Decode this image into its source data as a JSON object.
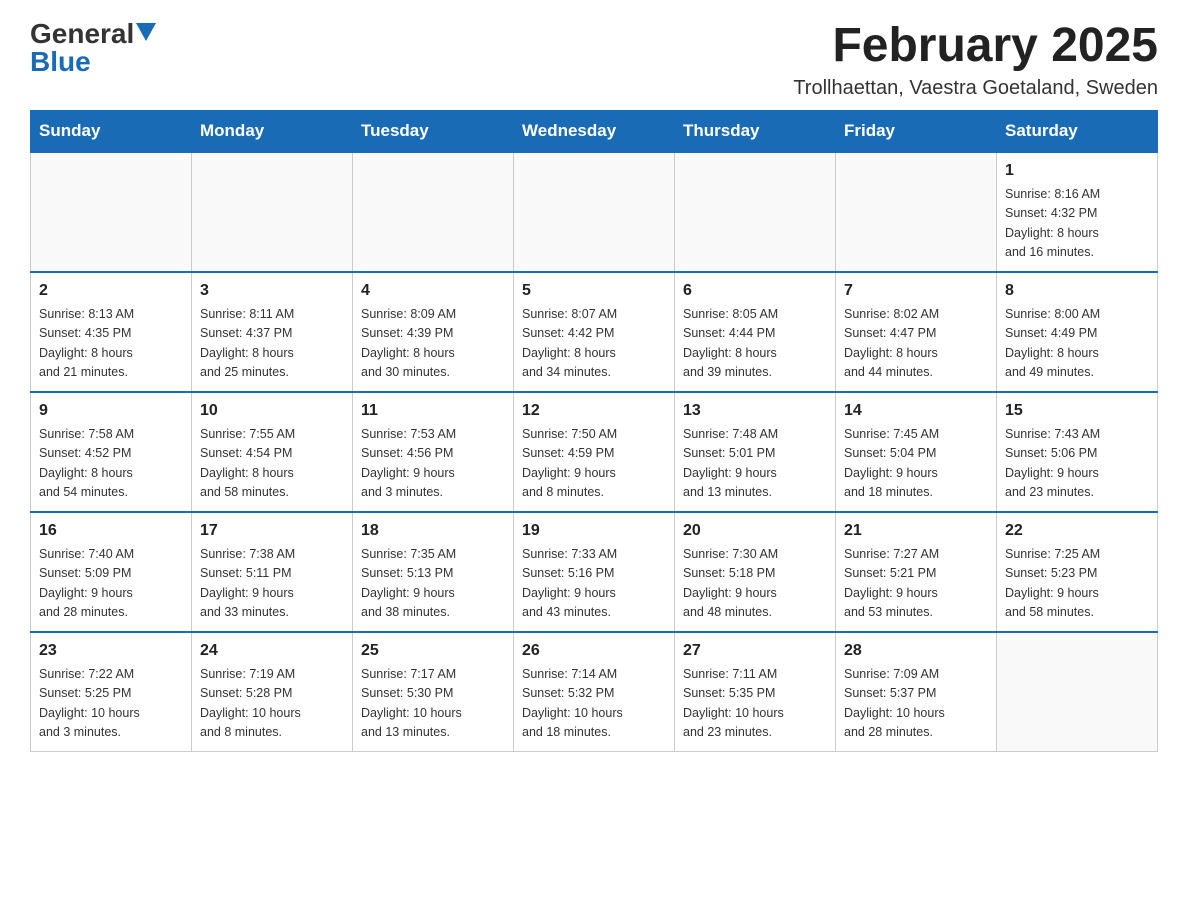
{
  "logo": {
    "general": "General",
    "blue": "Blue",
    "triangle": "▼"
  },
  "header": {
    "month_title": "February 2025",
    "location": "Trollhaettan, Vaestra Goetaland, Sweden"
  },
  "weekdays": [
    "Sunday",
    "Monday",
    "Tuesday",
    "Wednesday",
    "Thursday",
    "Friday",
    "Saturday"
  ],
  "weeks": [
    [
      {
        "day": "",
        "info": ""
      },
      {
        "day": "",
        "info": ""
      },
      {
        "day": "",
        "info": ""
      },
      {
        "day": "",
        "info": ""
      },
      {
        "day": "",
        "info": ""
      },
      {
        "day": "",
        "info": ""
      },
      {
        "day": "1",
        "info": "Sunrise: 8:16 AM\nSunset: 4:32 PM\nDaylight: 8 hours\nand 16 minutes."
      }
    ],
    [
      {
        "day": "2",
        "info": "Sunrise: 8:13 AM\nSunset: 4:35 PM\nDaylight: 8 hours\nand 21 minutes."
      },
      {
        "day": "3",
        "info": "Sunrise: 8:11 AM\nSunset: 4:37 PM\nDaylight: 8 hours\nand 25 minutes."
      },
      {
        "day": "4",
        "info": "Sunrise: 8:09 AM\nSunset: 4:39 PM\nDaylight: 8 hours\nand 30 minutes."
      },
      {
        "day": "5",
        "info": "Sunrise: 8:07 AM\nSunset: 4:42 PM\nDaylight: 8 hours\nand 34 minutes."
      },
      {
        "day": "6",
        "info": "Sunrise: 8:05 AM\nSunset: 4:44 PM\nDaylight: 8 hours\nand 39 minutes."
      },
      {
        "day": "7",
        "info": "Sunrise: 8:02 AM\nSunset: 4:47 PM\nDaylight: 8 hours\nand 44 minutes."
      },
      {
        "day": "8",
        "info": "Sunrise: 8:00 AM\nSunset: 4:49 PM\nDaylight: 8 hours\nand 49 minutes."
      }
    ],
    [
      {
        "day": "9",
        "info": "Sunrise: 7:58 AM\nSunset: 4:52 PM\nDaylight: 8 hours\nand 54 minutes."
      },
      {
        "day": "10",
        "info": "Sunrise: 7:55 AM\nSunset: 4:54 PM\nDaylight: 8 hours\nand 58 minutes."
      },
      {
        "day": "11",
        "info": "Sunrise: 7:53 AM\nSunset: 4:56 PM\nDaylight: 9 hours\nand 3 minutes."
      },
      {
        "day": "12",
        "info": "Sunrise: 7:50 AM\nSunset: 4:59 PM\nDaylight: 9 hours\nand 8 minutes."
      },
      {
        "day": "13",
        "info": "Sunrise: 7:48 AM\nSunset: 5:01 PM\nDaylight: 9 hours\nand 13 minutes."
      },
      {
        "day": "14",
        "info": "Sunrise: 7:45 AM\nSunset: 5:04 PM\nDaylight: 9 hours\nand 18 minutes."
      },
      {
        "day": "15",
        "info": "Sunrise: 7:43 AM\nSunset: 5:06 PM\nDaylight: 9 hours\nand 23 minutes."
      }
    ],
    [
      {
        "day": "16",
        "info": "Sunrise: 7:40 AM\nSunset: 5:09 PM\nDaylight: 9 hours\nand 28 minutes."
      },
      {
        "day": "17",
        "info": "Sunrise: 7:38 AM\nSunset: 5:11 PM\nDaylight: 9 hours\nand 33 minutes."
      },
      {
        "day": "18",
        "info": "Sunrise: 7:35 AM\nSunset: 5:13 PM\nDaylight: 9 hours\nand 38 minutes."
      },
      {
        "day": "19",
        "info": "Sunrise: 7:33 AM\nSunset: 5:16 PM\nDaylight: 9 hours\nand 43 minutes."
      },
      {
        "day": "20",
        "info": "Sunrise: 7:30 AM\nSunset: 5:18 PM\nDaylight: 9 hours\nand 48 minutes."
      },
      {
        "day": "21",
        "info": "Sunrise: 7:27 AM\nSunset: 5:21 PM\nDaylight: 9 hours\nand 53 minutes."
      },
      {
        "day": "22",
        "info": "Sunrise: 7:25 AM\nSunset: 5:23 PM\nDaylight: 9 hours\nand 58 minutes."
      }
    ],
    [
      {
        "day": "23",
        "info": "Sunrise: 7:22 AM\nSunset: 5:25 PM\nDaylight: 10 hours\nand 3 minutes."
      },
      {
        "day": "24",
        "info": "Sunrise: 7:19 AM\nSunset: 5:28 PM\nDaylight: 10 hours\nand 8 minutes."
      },
      {
        "day": "25",
        "info": "Sunrise: 7:17 AM\nSunset: 5:30 PM\nDaylight: 10 hours\nand 13 minutes."
      },
      {
        "day": "26",
        "info": "Sunrise: 7:14 AM\nSunset: 5:32 PM\nDaylight: 10 hours\nand 18 minutes."
      },
      {
        "day": "27",
        "info": "Sunrise: 7:11 AM\nSunset: 5:35 PM\nDaylight: 10 hours\nand 23 minutes."
      },
      {
        "day": "28",
        "info": "Sunrise: 7:09 AM\nSunset: 5:37 PM\nDaylight: 10 hours\nand 28 minutes."
      },
      {
        "day": "",
        "info": ""
      }
    ]
  ]
}
